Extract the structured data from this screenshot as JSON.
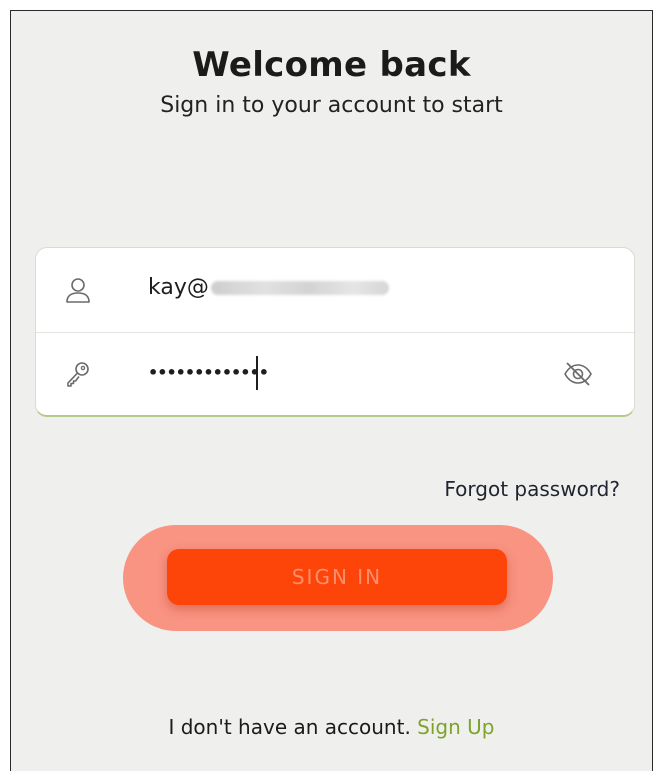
{
  "header": {
    "title": "Welcome back",
    "subtitle": "Sign in to your account to start"
  },
  "form": {
    "email": {
      "icon": "user-icon",
      "value": "kay@",
      "redacted": true
    },
    "password": {
      "icon": "key-icon",
      "value": "•••••••••••••",
      "toggle_icon": "eye-off-icon"
    }
  },
  "links": {
    "forgot_password": "Forgot password?"
  },
  "actions": {
    "sign_in_label": "SIGN IN"
  },
  "footer": {
    "prompt": "I don't have an account.",
    "sign_up_label": "Sign Up"
  },
  "colors": {
    "background": "#eff0ed",
    "primary_button": "#fd4509",
    "button_text": "#ff8f6c",
    "highlight": "#f98d7c",
    "link_green": "#7ea32b",
    "input_border_accent": "#b7c98a"
  }
}
